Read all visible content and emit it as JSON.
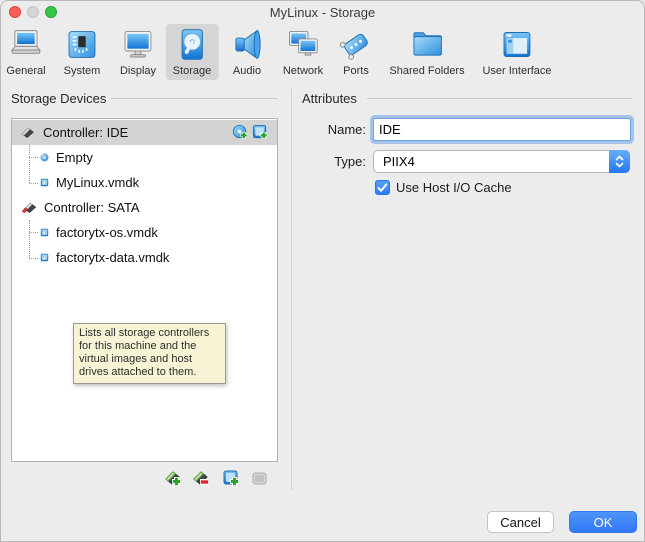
{
  "window": {
    "title": "MyLinux - Storage"
  },
  "toolbar": {
    "items": [
      {
        "label": "General"
      },
      {
        "label": "System"
      },
      {
        "label": "Display"
      },
      {
        "label": "Storage",
        "selected": true
      },
      {
        "label": "Audio"
      },
      {
        "label": "Network"
      },
      {
        "label": "Ports"
      },
      {
        "label": "Shared Folders"
      },
      {
        "label": "User Interface"
      }
    ]
  },
  "storage_panel": {
    "title": "Storage Devices",
    "tree": [
      {
        "label": "Controller: IDE",
        "icon": "ide-controller-icon",
        "selected": true
      },
      {
        "label": "Empty",
        "icon": "optical-disc-icon",
        "child_of": "Controller: IDE"
      },
      {
        "label": "MyLinux.vmdk",
        "icon": "hard-disk-icon",
        "child_of": "Controller: IDE"
      },
      {
        "label": "Controller: SATA",
        "icon": "sata-controller-icon"
      },
      {
        "label": "factorytx-os.vmdk",
        "icon": "hard-disk-icon",
        "child_of": "Controller: SATA"
      },
      {
        "label": "factorytx-data.vmdk",
        "icon": "hard-disk-icon",
        "child_of": "Controller: SATA"
      }
    ],
    "row_action_icons": [
      "add-optical-drive-icon",
      "add-hard-disk-icon"
    ],
    "tooltip": "Lists all storage controllers\nfor this machine and the\nvirtual images and host\ndrives attached to them.",
    "footer_icons": [
      "add-controller-icon",
      "remove-controller-icon",
      "add-attachment-icon",
      "remove-attachment-icon (disabled)"
    ]
  },
  "attributes_panel": {
    "title": "Attributes",
    "name_label": "Name:",
    "name_value": "IDE",
    "type_label": "Type:",
    "type_value": "PIIX4",
    "cache_label": "Use Host I/O Cache",
    "cache_checked": true
  },
  "footer": {
    "cancel_label": "Cancel",
    "ok_label": "OK"
  },
  "colors": {
    "accent_blue": "#3e86f7",
    "selection_gray": "#d3d3d3",
    "tooltip_bg": "#f6f4d4",
    "icon_blue": "#2d8fe0",
    "plus_green": "#2aa32a",
    "minus_red": "#d42a2a"
  }
}
